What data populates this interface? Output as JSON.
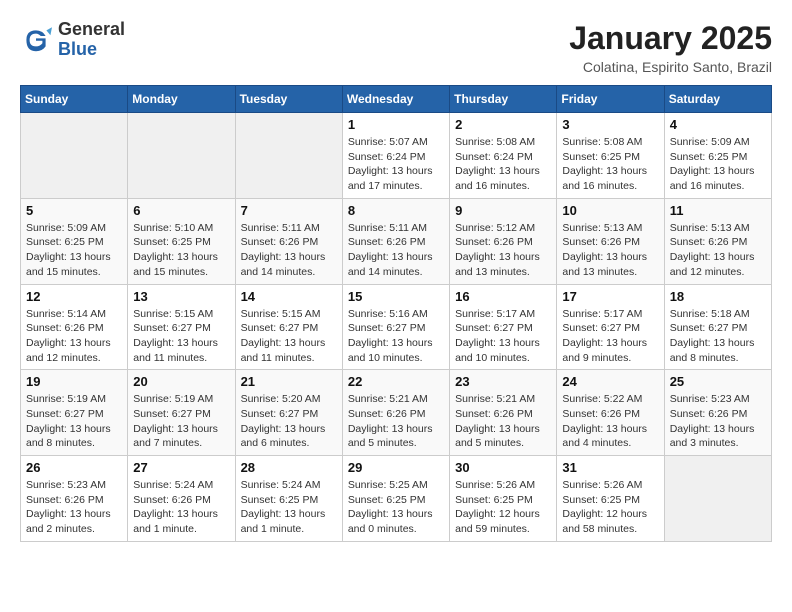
{
  "header": {
    "logo": {
      "general": "General",
      "blue": "Blue"
    },
    "title": "January 2025",
    "subtitle": "Colatina, Espirito Santo, Brazil"
  },
  "weekdays": [
    "Sunday",
    "Monday",
    "Tuesday",
    "Wednesday",
    "Thursday",
    "Friday",
    "Saturday"
  ],
  "weeks": [
    [
      {
        "day": "",
        "empty": true
      },
      {
        "day": "",
        "empty": true
      },
      {
        "day": "",
        "empty": true
      },
      {
        "day": "1",
        "sunrise": "5:07 AM",
        "sunset": "6:24 PM",
        "daylight": "13 hours and 17 minutes."
      },
      {
        "day": "2",
        "sunrise": "5:08 AM",
        "sunset": "6:24 PM",
        "daylight": "13 hours and 16 minutes."
      },
      {
        "day": "3",
        "sunrise": "5:08 AM",
        "sunset": "6:25 PM",
        "daylight": "13 hours and 16 minutes."
      },
      {
        "day": "4",
        "sunrise": "5:09 AM",
        "sunset": "6:25 PM",
        "daylight": "13 hours and 16 minutes."
      }
    ],
    [
      {
        "day": "5",
        "sunrise": "5:09 AM",
        "sunset": "6:25 PM",
        "daylight": "13 hours and 15 minutes."
      },
      {
        "day": "6",
        "sunrise": "5:10 AM",
        "sunset": "6:25 PM",
        "daylight": "13 hours and 15 minutes."
      },
      {
        "day": "7",
        "sunrise": "5:11 AM",
        "sunset": "6:26 PM",
        "daylight": "13 hours and 14 minutes."
      },
      {
        "day": "8",
        "sunrise": "5:11 AM",
        "sunset": "6:26 PM",
        "daylight": "13 hours and 14 minutes."
      },
      {
        "day": "9",
        "sunrise": "5:12 AM",
        "sunset": "6:26 PM",
        "daylight": "13 hours and 13 minutes."
      },
      {
        "day": "10",
        "sunrise": "5:13 AM",
        "sunset": "6:26 PM",
        "daylight": "13 hours and 13 minutes."
      },
      {
        "day": "11",
        "sunrise": "5:13 AM",
        "sunset": "6:26 PM",
        "daylight": "13 hours and 12 minutes."
      }
    ],
    [
      {
        "day": "12",
        "sunrise": "5:14 AM",
        "sunset": "6:26 PM",
        "daylight": "13 hours and 12 minutes."
      },
      {
        "day": "13",
        "sunrise": "5:15 AM",
        "sunset": "6:27 PM",
        "daylight": "13 hours and 11 minutes."
      },
      {
        "day": "14",
        "sunrise": "5:15 AM",
        "sunset": "6:27 PM",
        "daylight": "13 hours and 11 minutes."
      },
      {
        "day": "15",
        "sunrise": "5:16 AM",
        "sunset": "6:27 PM",
        "daylight": "13 hours and 10 minutes."
      },
      {
        "day": "16",
        "sunrise": "5:17 AM",
        "sunset": "6:27 PM",
        "daylight": "13 hours and 10 minutes."
      },
      {
        "day": "17",
        "sunrise": "5:17 AM",
        "sunset": "6:27 PM",
        "daylight": "13 hours and 9 minutes."
      },
      {
        "day": "18",
        "sunrise": "5:18 AM",
        "sunset": "6:27 PM",
        "daylight": "13 hours and 8 minutes."
      }
    ],
    [
      {
        "day": "19",
        "sunrise": "5:19 AM",
        "sunset": "6:27 PM",
        "daylight": "13 hours and 8 minutes."
      },
      {
        "day": "20",
        "sunrise": "5:19 AM",
        "sunset": "6:27 PM",
        "daylight": "13 hours and 7 minutes."
      },
      {
        "day": "21",
        "sunrise": "5:20 AM",
        "sunset": "6:27 PM",
        "daylight": "13 hours and 6 minutes."
      },
      {
        "day": "22",
        "sunrise": "5:21 AM",
        "sunset": "6:26 PM",
        "daylight": "13 hours and 5 minutes."
      },
      {
        "day": "23",
        "sunrise": "5:21 AM",
        "sunset": "6:26 PM",
        "daylight": "13 hours and 5 minutes."
      },
      {
        "day": "24",
        "sunrise": "5:22 AM",
        "sunset": "6:26 PM",
        "daylight": "13 hours and 4 minutes."
      },
      {
        "day": "25",
        "sunrise": "5:23 AM",
        "sunset": "6:26 PM",
        "daylight": "13 hours and 3 minutes."
      }
    ],
    [
      {
        "day": "26",
        "sunrise": "5:23 AM",
        "sunset": "6:26 PM",
        "daylight": "13 hours and 2 minutes."
      },
      {
        "day": "27",
        "sunrise": "5:24 AM",
        "sunset": "6:26 PM",
        "daylight": "13 hours and 1 minute."
      },
      {
        "day": "28",
        "sunrise": "5:24 AM",
        "sunset": "6:25 PM",
        "daylight": "13 hours and 1 minute."
      },
      {
        "day": "29",
        "sunrise": "5:25 AM",
        "sunset": "6:25 PM",
        "daylight": "13 hours and 0 minutes."
      },
      {
        "day": "30",
        "sunrise": "5:26 AM",
        "sunset": "6:25 PM",
        "daylight": "12 hours and 59 minutes."
      },
      {
        "day": "31",
        "sunrise": "5:26 AM",
        "sunset": "6:25 PM",
        "daylight": "12 hours and 58 minutes."
      },
      {
        "day": "",
        "empty": true
      }
    ]
  ]
}
